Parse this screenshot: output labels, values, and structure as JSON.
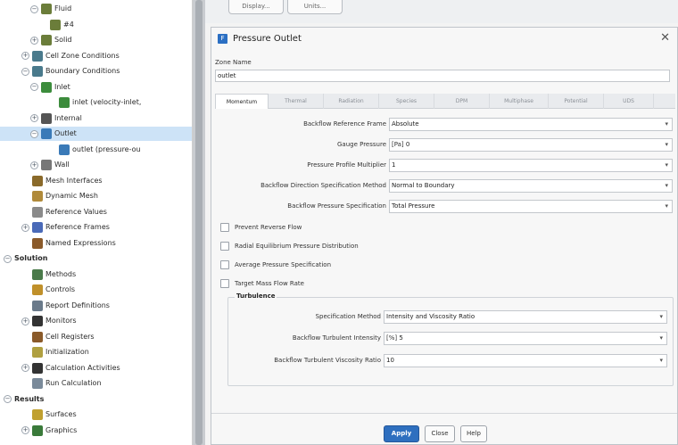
{
  "tree": {
    "items": [
      {
        "label": "Fluid",
        "indent": 3,
        "exp": "−",
        "icon": "fluid-icon",
        "color": "#6b7d3a"
      },
      {
        "label": "#4",
        "indent": 4,
        "exp": "",
        "icon": "fluid-icon",
        "color": "#6b7d3a"
      },
      {
        "label": "Solid",
        "indent": 3,
        "exp": "+",
        "icon": "solid-icon",
        "color": "#6b7d3a"
      },
      {
        "label": "Cell Zone Conditions",
        "indent": 2,
        "exp": "+",
        "icon": "cell-zone-icon",
        "color": "#4a7a8c"
      },
      {
        "label": "Boundary Conditions",
        "indent": 2,
        "exp": "−",
        "icon": "boundary-icon",
        "color": "#4a7a8c"
      },
      {
        "label": "Inlet",
        "indent": 3,
        "exp": "−",
        "icon": "inlet-icon",
        "color": "#3c8c3c"
      },
      {
        "label": "inlet (velocity-inlet,",
        "indent": 5,
        "exp": "",
        "icon": "inlet-item-icon",
        "color": "#3c8c3c"
      },
      {
        "label": "Internal",
        "indent": 3,
        "exp": "+",
        "icon": "internal-icon",
        "color": "#555"
      },
      {
        "label": "Outlet",
        "indent": 3,
        "exp": "−",
        "icon": "outlet-icon",
        "color": "#3a7ab8",
        "selected": true
      },
      {
        "label": "outlet (pressure-ou",
        "indent": 5,
        "exp": "",
        "icon": "outlet-item-icon",
        "color": "#3a7ab8"
      },
      {
        "label": "Wall",
        "indent": 3,
        "exp": "+",
        "icon": "wall-icon",
        "color": "#777"
      },
      {
        "label": "Mesh Interfaces",
        "indent": 2,
        "exp": "",
        "icon": "mesh-interfaces-icon",
        "color": "#8a6a2a"
      },
      {
        "label": "Dynamic Mesh",
        "indent": 2,
        "exp": "",
        "icon": "dynamic-mesh-icon",
        "color": "#b08a3a"
      },
      {
        "label": "Reference Values",
        "indent": 2,
        "exp": "",
        "icon": "reference-values-icon",
        "color": "#8a8a8a"
      },
      {
        "label": "Reference Frames",
        "indent": 2,
        "exp": "+",
        "icon": "reference-frames-icon",
        "color": "#4a6ab8"
      },
      {
        "label": "Named Expressions",
        "indent": 2,
        "exp": "",
        "icon": "named-expressions-icon",
        "color": "#8a5a2a"
      },
      {
        "label": "Solution",
        "indent": 0,
        "exp": "−",
        "icon": "",
        "color": "",
        "bold": true
      },
      {
        "label": "Methods",
        "indent": 2,
        "exp": "",
        "icon": "methods-icon",
        "color": "#4a7a4a"
      },
      {
        "label": "Controls",
        "indent": 2,
        "exp": "",
        "icon": "controls-icon",
        "color": "#c0902a"
      },
      {
        "label": "Report Definitions",
        "indent": 2,
        "exp": "",
        "icon": "report-definitions-icon",
        "color": "#6a7a8a"
      },
      {
        "label": "Monitors",
        "indent": 2,
        "exp": "+",
        "icon": "monitors-icon",
        "color": "#333"
      },
      {
        "label": "Cell Registers",
        "indent": 2,
        "exp": "",
        "icon": "cell-registers-icon",
        "color": "#8a5a2a"
      },
      {
        "label": "Initialization",
        "indent": 2,
        "exp": "",
        "icon": "initialization-icon",
        "color": "#b0a040"
      },
      {
        "label": "Calculation Activities",
        "indent": 2,
        "exp": "+",
        "icon": "calculation-activities-icon",
        "color": "#333"
      },
      {
        "label": "Run Calculation",
        "indent": 2,
        "exp": "",
        "icon": "run-calculation-icon",
        "color": "#7a8a9a"
      },
      {
        "label": "Results",
        "indent": 0,
        "exp": "−",
        "icon": "",
        "color": "",
        "bold": true
      },
      {
        "label": "Surfaces",
        "indent": 2,
        "exp": "",
        "icon": "surfaces-icon",
        "color": "#c0a030"
      },
      {
        "label": "Graphics",
        "indent": 2,
        "exp": "+",
        "icon": "graphics-icon",
        "color": "#3a7a3a"
      }
    ]
  },
  "background": {
    "btn1": "Display...",
    "btn2": "Units..."
  },
  "dialog": {
    "title": "Pressure Outlet",
    "close": "✕",
    "zone_name_label": "Zone Name",
    "zone_name_value": "outlet",
    "tabs": [
      "Momentum",
      "Thermal",
      "Radiation",
      "Species",
      "DPM",
      "Multiphase",
      "Potential",
      "UDS"
    ],
    "fields": {
      "backflow_ref_frame": {
        "label": "Backflow Reference Frame",
        "value": "Absolute"
      },
      "gauge_pressure": {
        "label": "Gauge Pressure",
        "unit": "[Pa]",
        "value": "0"
      },
      "pressure_profile_multiplier": {
        "label": "Pressure Profile Multiplier",
        "value": "1"
      },
      "backflow_direction": {
        "label": "Backflow Direction Specification Method",
        "value": "Normal to Boundary"
      },
      "backflow_pressure_spec": {
        "label": "Backflow Pressure Specification",
        "value": "Total Pressure"
      }
    },
    "checkboxes": [
      "Prevent Reverse Flow",
      "Radial Equilibrium Pressure Distribution",
      "Average Pressure Specification",
      "Target Mass Flow Rate"
    ],
    "turbulence": {
      "title": "Turbulence",
      "spec_method": {
        "label": "Specification Method",
        "value": "Intensity and Viscosity Ratio"
      },
      "intensity": {
        "label": "Backflow Turbulent Intensity",
        "unit": "[%]",
        "value": "5"
      },
      "viscosity_ratio": {
        "label": "Backflow Turbulent Viscosity Ratio",
        "value": "10"
      }
    },
    "buttons": {
      "apply": "Apply",
      "close": "Close",
      "help": "Help"
    }
  },
  "colors": {
    "accent": "#2e6fbf",
    "selected_row": "#cde3f7"
  }
}
